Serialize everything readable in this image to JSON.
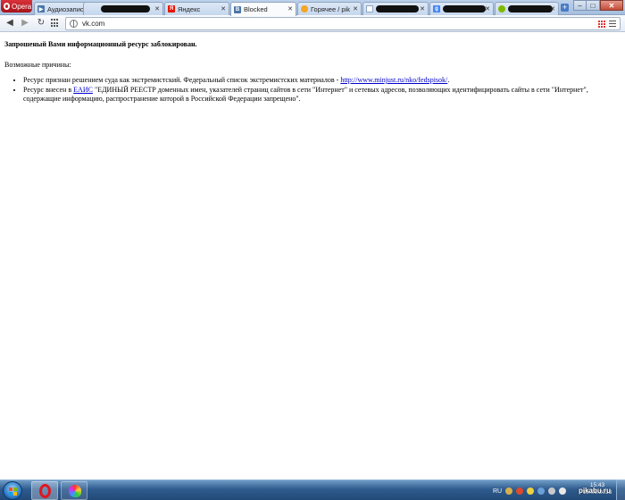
{
  "browser": {
    "menu_label": "Opera",
    "tabs": [
      {
        "label": "Аудиозаписи",
        "favicon_color": "#4a76a8",
        "favicon_glyph": ""
      },
      {
        "label": "",
        "favicon_color": "#333333",
        "favicon_glyph": "",
        "redacted": true
      },
      {
        "label": "Яндекс",
        "favicon_color": "#e61400",
        "favicon_glyph": "Я"
      },
      {
        "label": "Blocked",
        "favicon_color": "#4a76a8",
        "favicon_glyph": ""
      },
      {
        "label": "Горячее / pik",
        "favicon_color": "#f5a623",
        "favicon_glyph": ""
      },
      {
        "label": "",
        "favicon_color": "#8ea4c1",
        "favicon_glyph": "",
        "redacted": true
      },
      {
        "label": "",
        "favicon_color": "#4285f4",
        "favicon_glyph": "g",
        "redacted": true
      },
      {
        "label": "",
        "favicon_color": "#7fba00",
        "favicon_glyph": "",
        "redacted": true
      }
    ],
    "address": "vk.com"
  },
  "page": {
    "heading": "Запрошеный Вами информационный ресурс заблокирован.",
    "reasons_title": "Возможные причины:",
    "reason1_text": "Ресурс признан решением суда как экстремистский. Федеральный список экстремистских материалов - ",
    "reason1_link": "http://www.minjust.ru/nko/fedspisok/",
    "reason1_tail": ".",
    "reason2_prefix": "Ресурс внесен в ",
    "reason2_link": "ЕАИС",
    "reason2_text": " \"ЕДИНЫЙ РЕЕСТР доменных имен, указателей страниц сайтов в сети \"Интернет\" и сетевых адресов, позволяющих идентифицировать сайты в сети \"Интернет\", содержащие информацию, распространение которой в Российской Федерации запрещено\"."
  },
  "taskbar": {
    "lang": "RU",
    "time": "15:43",
    "date": "19.08.2013"
  },
  "watermark": "pikabu.ru"
}
